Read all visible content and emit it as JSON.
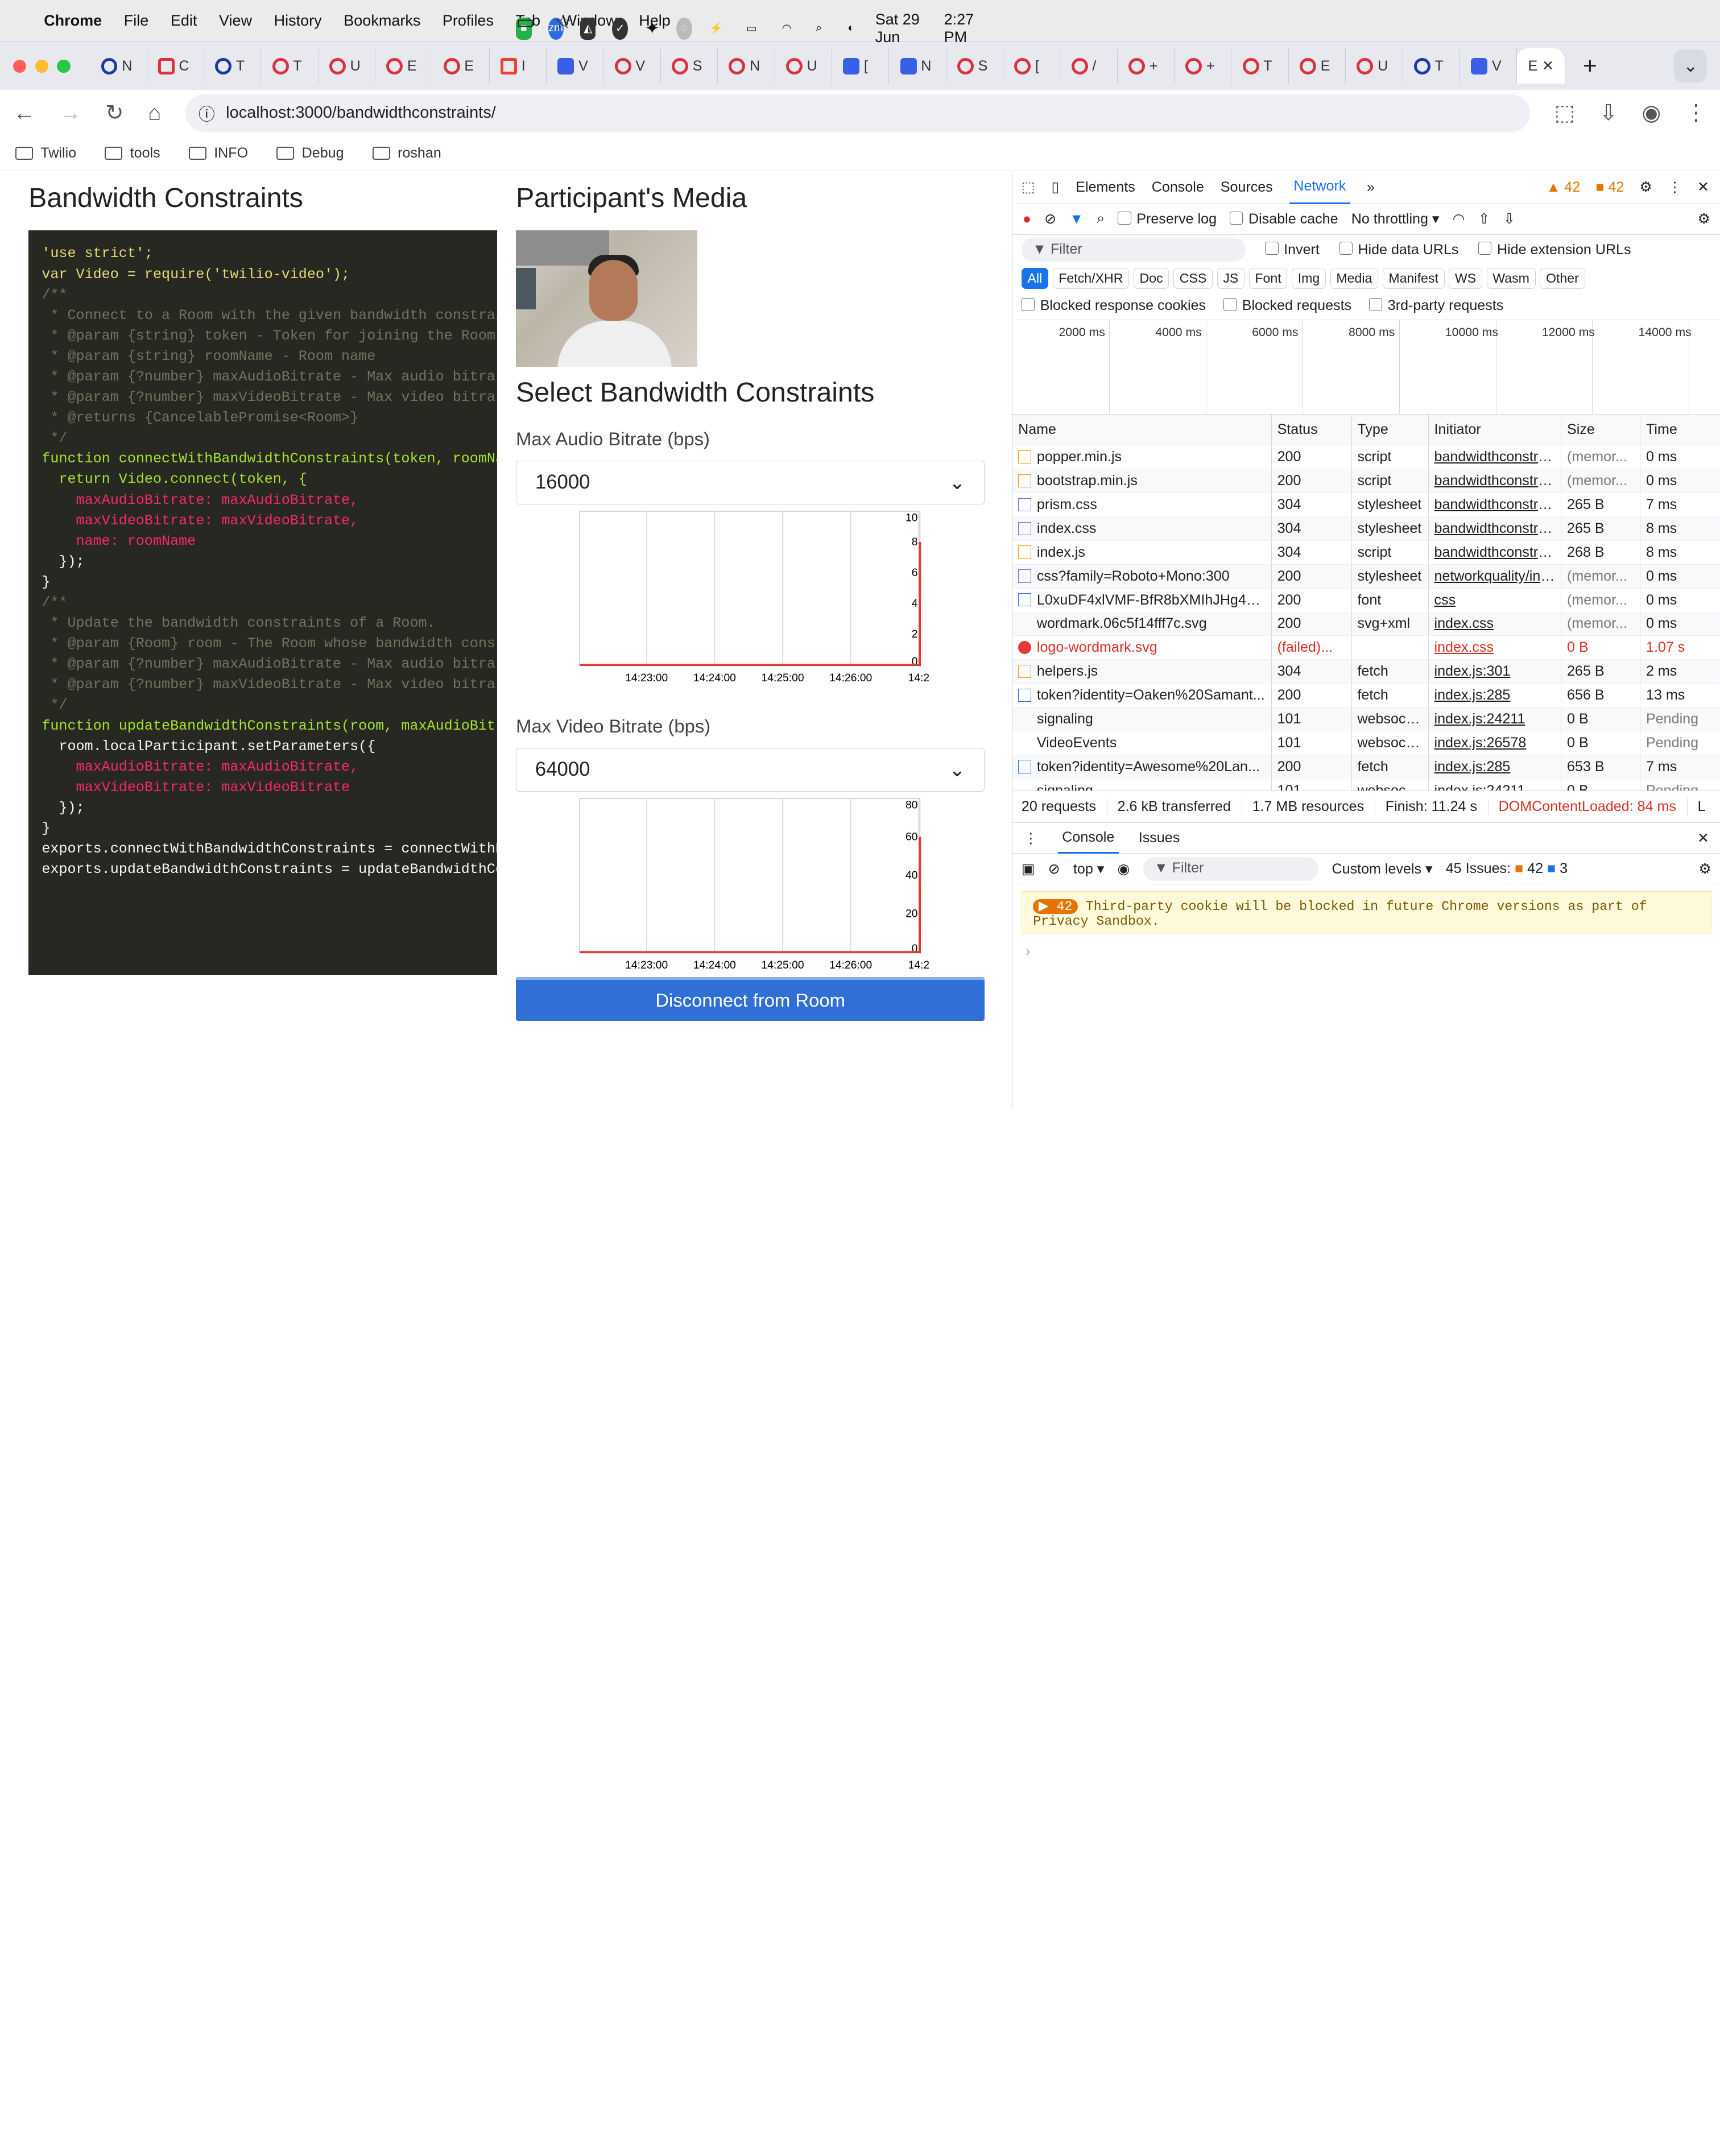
{
  "system": {
    "menu": [
      "Chrome",
      "File",
      "Edit",
      "View",
      "History",
      "Bookmarks",
      "Profiles",
      "Tab",
      "Window",
      "Help"
    ],
    "date": "Sat 29 Jun",
    "time": "2:27 PM"
  },
  "browser": {
    "url": "localhost:3000/bandwidthconstraints/",
    "bookmarks": [
      "Twilio",
      "tools",
      "INFO",
      "Debug",
      "roshan"
    ]
  },
  "page": {
    "title": "Bandwidth Constraints",
    "participant_title": "Participant's Media",
    "select_title": "Select Bandwidth Constraints",
    "audio_label": "Max Audio Bitrate (bps)",
    "audio_value": "16000",
    "video_label": "Max Video Bitrate (bps)",
    "video_value": "64000",
    "button": "Disconnect from Room",
    "code": [
      "'use strict';",
      "",
      "var Video = require('twilio-video');",
      "",
      "/**",
      " * Connect to a Room with the given bandwidth constraint",
      " * @param {string} token - Token for joining the Room",
      " * @param {string} roomName - Room name",
      " * @param {?number} maxAudioBitrate - Max audio bitrate",
      " * @param {?number} maxVideoBitrate - Max video bitrate",
      " * @returns {CancelablePromise<Room>}",
      " */",
      "function connectWithBandwidthConstraints(token, roomName",
      "  return Video.connect(token, {",
      "    maxAudioBitrate: maxAudioBitrate,",
      "    maxVideoBitrate: maxVideoBitrate,",
      "    name: roomName",
      "  });",
      "}",
      "",
      "/**",
      " * Update the bandwidth constraints of a Room.",
      " * @param {Room} room - The Room whose bandwidth constra",
      " * @param {?number} maxAudioBitrate - Max audio bitrate",
      " * @param {?number} maxVideoBitrate - Max video bitrate",
      " */",
      "function updateBandwidthConstraints(room, maxAudioBitrat",
      "  room.localParticipant.setParameters({",
      "    maxAudioBitrate: maxAudioBitrate,",
      "    maxVideoBitrate: maxVideoBitrate",
      "  });",
      "}",
      "",
      "exports.connectWithBandwidthConstraints = connectWithBar",
      "exports.updateBandwidthConstraints = updateBandwidthCons"
    ]
  },
  "chart_data": [
    {
      "type": "line",
      "categories": [
        "14:23:00",
        "14:24:00",
        "14:25:00",
        "14:26:00",
        "14:2"
      ],
      "ylim": [
        0,
        10
      ],
      "y_ticks": [
        "0",
        "2",
        "4",
        "6",
        "8",
        "10"
      ],
      "series": [
        {
          "values": [
            0,
            0,
            0,
            0,
            8
          ]
        }
      ]
    },
    {
      "type": "line",
      "categories": [
        "14:23:00",
        "14:24:00",
        "14:25:00",
        "14:26:00",
        "14:2"
      ],
      "ylim": [
        0,
        80
      ],
      "y_ticks": [
        "0",
        "20",
        "40",
        "60",
        "80"
      ],
      "series": [
        {
          "values": [
            0,
            0,
            0,
            0,
            60
          ]
        }
      ]
    }
  ],
  "devtools": {
    "tabs": [
      "Elements",
      "Console",
      "Sources",
      "Network"
    ],
    "warnings": "42",
    "errors": "42",
    "toolbar": {
      "preserve": "Preserve log",
      "disable": "Disable cache",
      "throttle": "No throttling"
    },
    "filter": "Filter",
    "filters": [
      "Invert",
      "Hide data URLs",
      "Hide extension URLs"
    ],
    "types": [
      "All",
      "Fetch/XHR",
      "Doc",
      "CSS",
      "JS",
      "Font",
      "Img",
      "Media",
      "Manifest",
      "WS",
      "Wasm",
      "Other"
    ],
    "blocked": [
      "Blocked response cookies",
      "Blocked requests",
      "3rd-party requests"
    ],
    "timeline": [
      "2000 ms",
      "4000 ms",
      "6000 ms",
      "8000 ms",
      "10000 ms",
      "12000 ms",
      "14000 ms"
    ],
    "headers": [
      "Name",
      "Status",
      "Type",
      "Initiator",
      "Size",
      "Time"
    ],
    "rows": [
      [
        "popper.min.js",
        "200",
        "script",
        "bandwidthconstrain",
        "(memor...",
        "0 ms",
        "js"
      ],
      [
        "bootstrap.min.js",
        "200",
        "script",
        "bandwidthconstrain",
        "(memor...",
        "0 ms",
        "js"
      ],
      [
        "prism.css",
        "304",
        "stylesheet",
        "bandwidthconstrain",
        "265 B",
        "7 ms",
        "css"
      ],
      [
        "index.css",
        "304",
        "stylesheet",
        "bandwidthconstrain",
        "265 B",
        "8 ms",
        "css"
      ],
      [
        "index.js",
        "304",
        "script",
        "bandwidthconstrain",
        "268 B",
        "8 ms",
        "js"
      ],
      [
        "css?family=Roboto+Mono:300",
        "200",
        "stylesheet",
        "networkquality/inde",
        "(memor...",
        "0 ms",
        "css"
      ],
      [
        "L0xuDF4xlVMF-BfR8bXMIhJHg45...",
        "200",
        "font",
        "css",
        "(memor...",
        "0 ms",
        "doc"
      ],
      [
        "wordmark.06c5f14fff7c.svg",
        "200",
        "svg+xml",
        "index.css",
        "(memor...",
        "0 ms",
        "ws"
      ],
      [
        "logo-wordmark.svg",
        "(failed)...",
        "",
        "index.css",
        "0 B",
        "1.07 s",
        "err"
      ],
      [
        "helpers.js",
        "304",
        "fetch",
        "index.js:301",
        "265 B",
        "2 ms",
        "js"
      ],
      [
        "token?identity=Oaken%20Samant...",
        "200",
        "fetch",
        "index.js:285",
        "656 B",
        "13 ms",
        "doc"
      ],
      [
        "signaling",
        "101",
        "websock...",
        "index.js:24211",
        "0 B",
        "Pending",
        "ws"
      ],
      [
        "VideoEvents",
        "101",
        "websock...",
        "index.js:26578",
        "0 B",
        "Pending",
        "ws"
      ],
      [
        "token?identity=Awesome%20Lan...",
        "200",
        "fetch",
        "index.js:285",
        "653 B",
        "7 ms",
        "doc"
      ],
      [
        "signaling",
        "101",
        "websock...",
        "index.js:24211",
        "0 B",
        "Pending",
        "ws"
      ]
    ],
    "summary": [
      "20 requests",
      "2.6 kB transferred",
      "1.7 MB resources",
      "Finish: 11.24 s",
      "DOMContentLoaded: 84 ms",
      "L"
    ],
    "console_tabs": [
      "Console",
      "Issues"
    ],
    "console_toolbar": {
      "top": "top",
      "filter": "Filter",
      "levels": "Custom levels",
      "issues": "45 Issues:",
      "warn": "42",
      "info": "3"
    },
    "console_count": "42",
    "console_message": "Third-party cookie will be blocked in future Chrome versions as part of Privacy Sandbox."
  }
}
